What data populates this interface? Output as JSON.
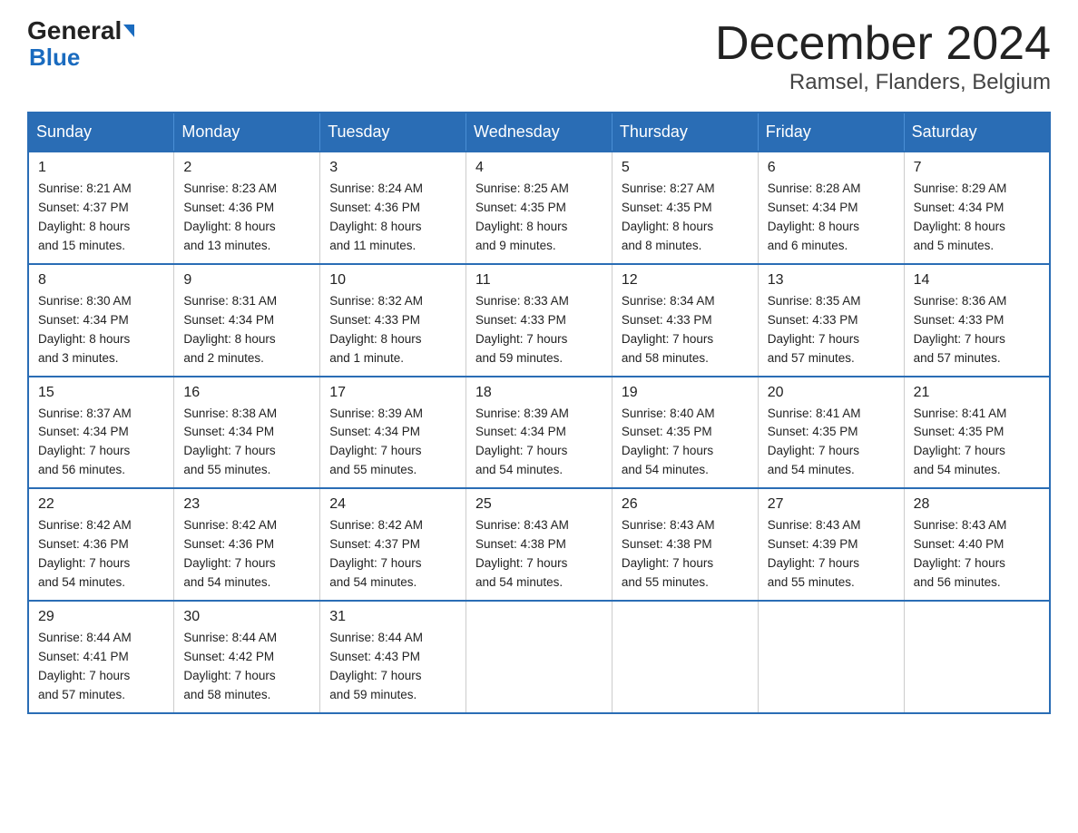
{
  "logo": {
    "line1": "General",
    "arrow": "▶",
    "line2": "Blue"
  },
  "header": {
    "month_year": "December 2024",
    "location": "Ramsel, Flanders, Belgium"
  },
  "days_of_week": [
    "Sunday",
    "Monday",
    "Tuesday",
    "Wednesday",
    "Thursday",
    "Friday",
    "Saturday"
  ],
  "weeks": [
    [
      {
        "day": "1",
        "info": "Sunrise: 8:21 AM\nSunset: 4:37 PM\nDaylight: 8 hours\nand 15 minutes."
      },
      {
        "day": "2",
        "info": "Sunrise: 8:23 AM\nSunset: 4:36 PM\nDaylight: 8 hours\nand 13 minutes."
      },
      {
        "day": "3",
        "info": "Sunrise: 8:24 AM\nSunset: 4:36 PM\nDaylight: 8 hours\nand 11 minutes."
      },
      {
        "day": "4",
        "info": "Sunrise: 8:25 AM\nSunset: 4:35 PM\nDaylight: 8 hours\nand 9 minutes."
      },
      {
        "day": "5",
        "info": "Sunrise: 8:27 AM\nSunset: 4:35 PM\nDaylight: 8 hours\nand 8 minutes."
      },
      {
        "day": "6",
        "info": "Sunrise: 8:28 AM\nSunset: 4:34 PM\nDaylight: 8 hours\nand 6 minutes."
      },
      {
        "day": "7",
        "info": "Sunrise: 8:29 AM\nSunset: 4:34 PM\nDaylight: 8 hours\nand 5 minutes."
      }
    ],
    [
      {
        "day": "8",
        "info": "Sunrise: 8:30 AM\nSunset: 4:34 PM\nDaylight: 8 hours\nand 3 minutes."
      },
      {
        "day": "9",
        "info": "Sunrise: 8:31 AM\nSunset: 4:34 PM\nDaylight: 8 hours\nand 2 minutes."
      },
      {
        "day": "10",
        "info": "Sunrise: 8:32 AM\nSunset: 4:33 PM\nDaylight: 8 hours\nand 1 minute."
      },
      {
        "day": "11",
        "info": "Sunrise: 8:33 AM\nSunset: 4:33 PM\nDaylight: 7 hours\nand 59 minutes."
      },
      {
        "day": "12",
        "info": "Sunrise: 8:34 AM\nSunset: 4:33 PM\nDaylight: 7 hours\nand 58 minutes."
      },
      {
        "day": "13",
        "info": "Sunrise: 8:35 AM\nSunset: 4:33 PM\nDaylight: 7 hours\nand 57 minutes."
      },
      {
        "day": "14",
        "info": "Sunrise: 8:36 AM\nSunset: 4:33 PM\nDaylight: 7 hours\nand 57 minutes."
      }
    ],
    [
      {
        "day": "15",
        "info": "Sunrise: 8:37 AM\nSunset: 4:34 PM\nDaylight: 7 hours\nand 56 minutes."
      },
      {
        "day": "16",
        "info": "Sunrise: 8:38 AM\nSunset: 4:34 PM\nDaylight: 7 hours\nand 55 minutes."
      },
      {
        "day": "17",
        "info": "Sunrise: 8:39 AM\nSunset: 4:34 PM\nDaylight: 7 hours\nand 55 minutes."
      },
      {
        "day": "18",
        "info": "Sunrise: 8:39 AM\nSunset: 4:34 PM\nDaylight: 7 hours\nand 54 minutes."
      },
      {
        "day": "19",
        "info": "Sunrise: 8:40 AM\nSunset: 4:35 PM\nDaylight: 7 hours\nand 54 minutes."
      },
      {
        "day": "20",
        "info": "Sunrise: 8:41 AM\nSunset: 4:35 PM\nDaylight: 7 hours\nand 54 minutes."
      },
      {
        "day": "21",
        "info": "Sunrise: 8:41 AM\nSunset: 4:35 PM\nDaylight: 7 hours\nand 54 minutes."
      }
    ],
    [
      {
        "day": "22",
        "info": "Sunrise: 8:42 AM\nSunset: 4:36 PM\nDaylight: 7 hours\nand 54 minutes."
      },
      {
        "day": "23",
        "info": "Sunrise: 8:42 AM\nSunset: 4:36 PM\nDaylight: 7 hours\nand 54 minutes."
      },
      {
        "day": "24",
        "info": "Sunrise: 8:42 AM\nSunset: 4:37 PM\nDaylight: 7 hours\nand 54 minutes."
      },
      {
        "day": "25",
        "info": "Sunrise: 8:43 AM\nSunset: 4:38 PM\nDaylight: 7 hours\nand 54 minutes."
      },
      {
        "day": "26",
        "info": "Sunrise: 8:43 AM\nSunset: 4:38 PM\nDaylight: 7 hours\nand 55 minutes."
      },
      {
        "day": "27",
        "info": "Sunrise: 8:43 AM\nSunset: 4:39 PM\nDaylight: 7 hours\nand 55 minutes."
      },
      {
        "day": "28",
        "info": "Sunrise: 8:43 AM\nSunset: 4:40 PM\nDaylight: 7 hours\nand 56 minutes."
      }
    ],
    [
      {
        "day": "29",
        "info": "Sunrise: 8:44 AM\nSunset: 4:41 PM\nDaylight: 7 hours\nand 57 minutes."
      },
      {
        "day": "30",
        "info": "Sunrise: 8:44 AM\nSunset: 4:42 PM\nDaylight: 7 hours\nand 58 minutes."
      },
      {
        "day": "31",
        "info": "Sunrise: 8:44 AM\nSunset: 4:43 PM\nDaylight: 7 hours\nand 59 minutes."
      },
      {
        "day": "",
        "info": ""
      },
      {
        "day": "",
        "info": ""
      },
      {
        "day": "",
        "info": ""
      },
      {
        "day": "",
        "info": ""
      }
    ]
  ]
}
